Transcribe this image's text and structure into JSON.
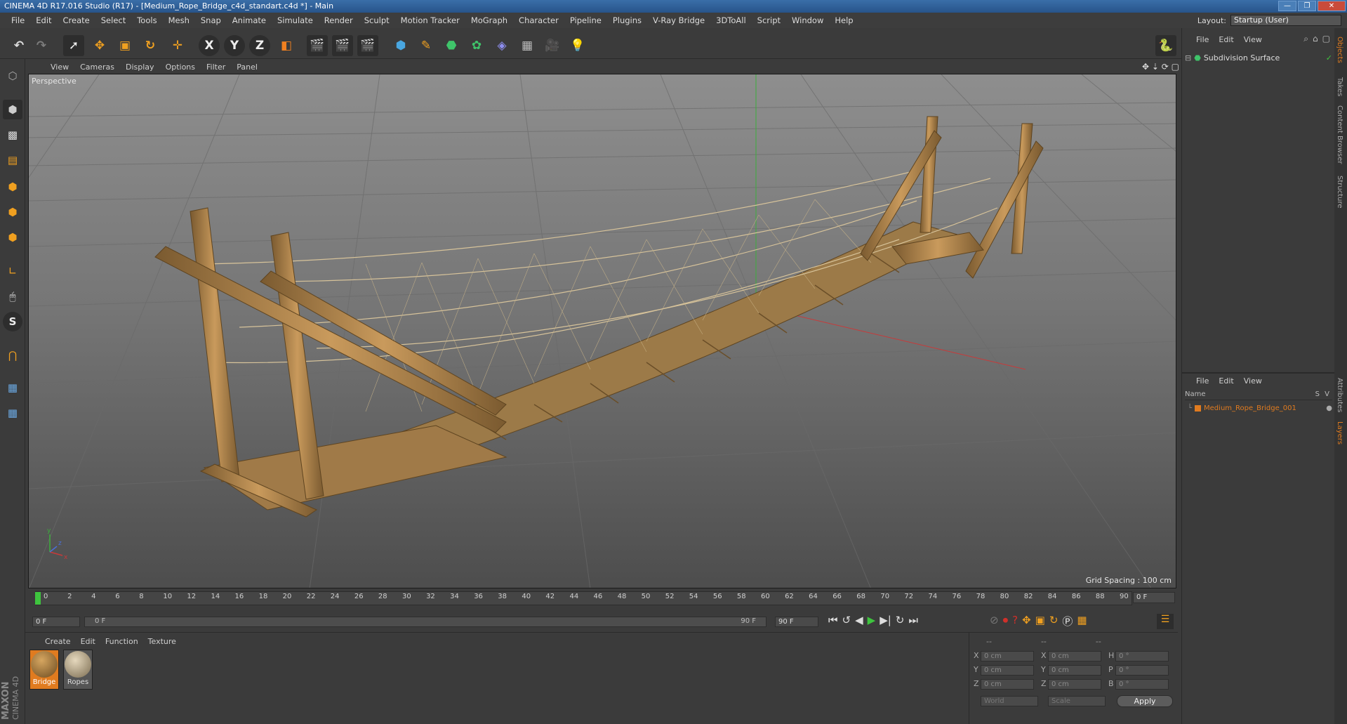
{
  "window": {
    "title": "CINEMA 4D R17.016 Studio (R17) - [Medium_Rope_Bridge_c4d_standart.c4d *] - Main",
    "buttons": [
      "—",
      "❐",
      "✕"
    ]
  },
  "menubar": {
    "items": [
      "File",
      "Edit",
      "Create",
      "Select",
      "Tools",
      "Mesh",
      "Snap",
      "Animate",
      "Simulate",
      "Render",
      "Sculpt",
      "Motion Tracker",
      "MoGraph",
      "Character",
      "Pipeline",
      "Plugins",
      "V-Ray Bridge",
      "3DToAll",
      "Script",
      "Window",
      "Help"
    ],
    "layout_label": "Layout:",
    "layout_value": "Startup (User)"
  },
  "toolbar": {
    "axis_x": "X",
    "axis_y": "Y",
    "axis_z": "Z"
  },
  "viewport": {
    "menu": [
      "View",
      "Cameras",
      "Display",
      "Options",
      "Filter",
      "Panel"
    ],
    "camera_label": "Perspective",
    "grid_spacing": "Grid Spacing : 100 cm",
    "axis_labels": {
      "x": "x",
      "y": "y",
      "z": "z"
    }
  },
  "timeline": {
    "ticks": [
      "0",
      "2",
      "4",
      "6",
      "8",
      "10",
      "12",
      "14",
      "16",
      "18",
      "20",
      "22",
      "24",
      "26",
      "28",
      "30",
      "32",
      "34",
      "36",
      "38",
      "40",
      "42",
      "44",
      "46",
      "48",
      "50",
      "52",
      "54",
      "56",
      "58",
      "60",
      "62",
      "64",
      "66",
      "68",
      "70",
      "72",
      "74",
      "76",
      "78",
      "80",
      "82",
      "84",
      "86",
      "88",
      "90"
    ],
    "current_frame": "0 F",
    "start_field": "0 F",
    "range_start": "0 F",
    "range_end": "90 F",
    "end_field": "90 F"
  },
  "materials": {
    "menu": [
      "Create",
      "Edit",
      "Function",
      "Texture"
    ],
    "items": [
      {
        "name": "Bridge",
        "selected": true
      },
      {
        "name": "Ropes",
        "selected": false
      }
    ],
    "brand_top": "MAXON",
    "brand_bottom": "CINEMA 4D"
  },
  "coordinates": {
    "headers": [
      "--",
      "--",
      "--"
    ],
    "rows": [
      {
        "axis": "X",
        "pos": "0 cm",
        "axis2": "X",
        "size": "0 cm",
        "rot_label": "H",
        "rot": "0 °"
      },
      {
        "axis": "Y",
        "pos": "0 cm",
        "axis2": "Y",
        "size": "0 cm",
        "rot_label": "P",
        "rot": "0 °"
      },
      {
        "axis": "Z",
        "pos": "0 cm",
        "axis2": "Z",
        "size": "0 cm",
        "rot_label": "B",
        "rot": "0 °"
      }
    ],
    "mode_world": "World",
    "mode_scale": "Scale",
    "apply": "Apply"
  },
  "objects": {
    "menu": [
      "File",
      "Edit",
      "View"
    ],
    "items": [
      {
        "name": "Subdivision Surface"
      }
    ]
  },
  "layers": {
    "menu": [
      "File",
      "Edit",
      "View"
    ],
    "col_name": "Name",
    "col_s": "S",
    "col_v": "V",
    "items": [
      {
        "name": "Medium_Rope_Bridge_001",
        "color": "#e07b1f"
      }
    ]
  },
  "side_tabs": [
    "Objects",
    "Takes",
    "Content Browser",
    "Structure",
    "Attributes",
    "Layers"
  ],
  "colors": {
    "accent_orange": "#e07b1f",
    "play_green": "#3ec43e",
    "record_red": "#d0302a",
    "wood": "#b8894e"
  }
}
